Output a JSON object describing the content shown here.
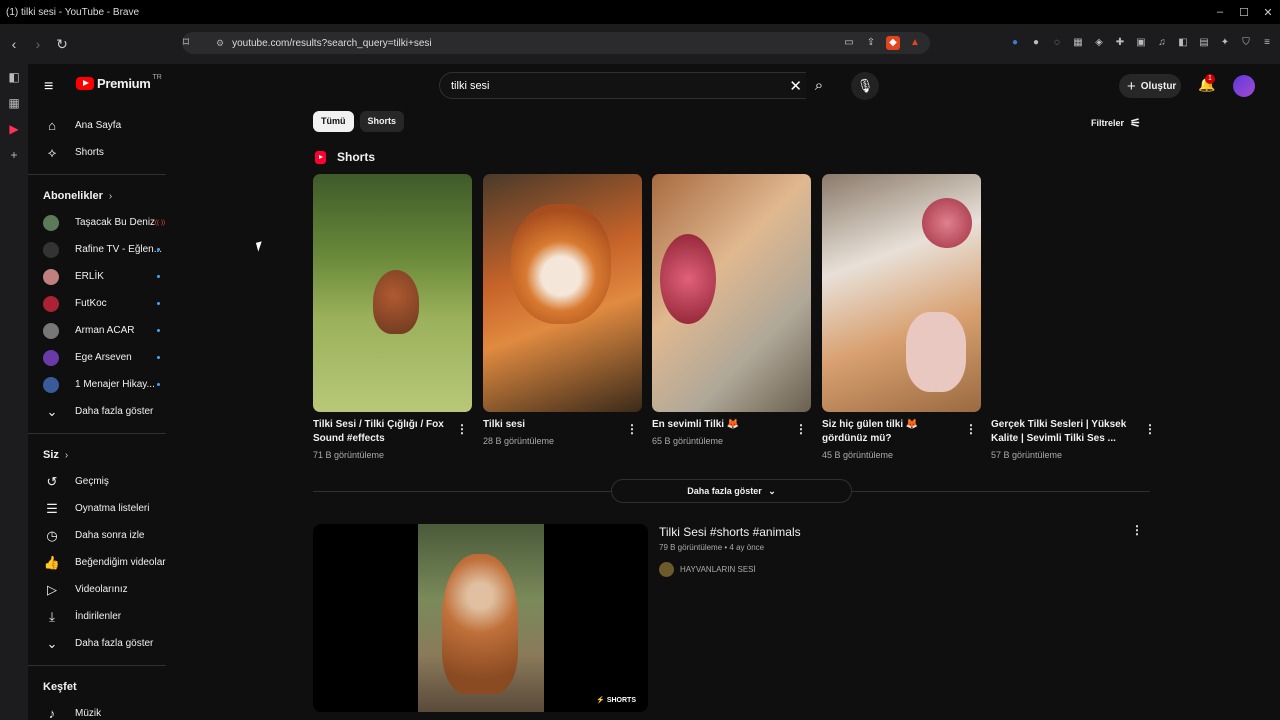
{
  "window": {
    "title": "(1) tilki sesi - YouTube - Brave"
  },
  "browser": {
    "url": "youtube.com/results?search_query=tilki+sesi"
  },
  "brand": {
    "name": "Premium",
    "region": "TR"
  },
  "search": {
    "query": "tilki sesi"
  },
  "header": {
    "create_label": "Oluştur",
    "notification_count": "1"
  },
  "sidebar": {
    "main": [
      {
        "label": "Ana Sayfa",
        "icon": "home-icon"
      },
      {
        "label": "Shorts",
        "icon": "shorts-icon"
      }
    ],
    "subscriptions_title": "Abonelikler",
    "subscriptions": [
      {
        "label": "Taşacak Bu Deniz",
        "live": true,
        "avatar_color": "#5a7a5a"
      },
      {
        "label": "Rafine TV - Eğlen...",
        "live": false,
        "avatar_color": "#333333"
      },
      {
        "label": "ERLİK",
        "live": false,
        "avatar_color": "#c08080"
      },
      {
        "label": "FutKoc",
        "live": false,
        "avatar_color": "#aa2233"
      },
      {
        "label": "Arman ACAR",
        "live": false,
        "avatar_color": "#777777"
      },
      {
        "label": "Ege Arseven",
        "live": false,
        "avatar_color": "#6a3aa6"
      },
      {
        "label": "1 Menajer Hikay...",
        "live": false,
        "avatar_color": "#3a5a9a"
      }
    ],
    "show_more": "Daha fazla göster",
    "you_title": "Siz",
    "you": [
      {
        "label": "Geçmiş",
        "icon": "history-icon"
      },
      {
        "label": "Oynatma listeleri",
        "icon": "playlist-icon"
      },
      {
        "label": "Daha sonra izle",
        "icon": "clock-icon"
      },
      {
        "label": "Beğendiğim videolar",
        "icon": "like-icon"
      },
      {
        "label": "Videolarınız",
        "icon": "video-icon"
      },
      {
        "label": "İndirilenler",
        "icon": "download-icon"
      }
    ],
    "you_more": "Daha fazla göster",
    "explore_title": "Keşfet",
    "explore": [
      {
        "label": "Müzik",
        "icon": "music-icon"
      }
    ],
    "live_badge": "((·))"
  },
  "chips": [
    {
      "label": "Tümü",
      "active": true
    },
    {
      "label": "Shorts",
      "active": false
    }
  ],
  "filters_label": "Filtreler",
  "shorts_section": {
    "title": "Shorts",
    "items": [
      {
        "title": "Tilki Sesi / Tilki Çığlığı / Fox Sound  #effects",
        "views": "71 B görüntüleme"
      },
      {
        "title": "Tilki sesi",
        "views": "28 B görüntüleme"
      },
      {
        "title": "En sevimli Tilki 🦊",
        "views": "65 B görüntüleme"
      },
      {
        "title": "Siz hiç gülen tilki 🦊 gördünüz mü?",
        "views": "45 B görüntüleme"
      },
      {
        "title": "Gerçek Tilki Sesleri | Yüksek Kalite | Sevimli Tilki Ses ...",
        "views": "57 B görüntüleme"
      }
    ],
    "show_more": "Daha fazla göster"
  },
  "video_result": {
    "title": "Tilki Sesi #shorts #animals",
    "meta": "79 B görüntüleme • 4 ay önce",
    "channel": "HAYVANLARIN SESİ",
    "badge": "SHORTS"
  }
}
